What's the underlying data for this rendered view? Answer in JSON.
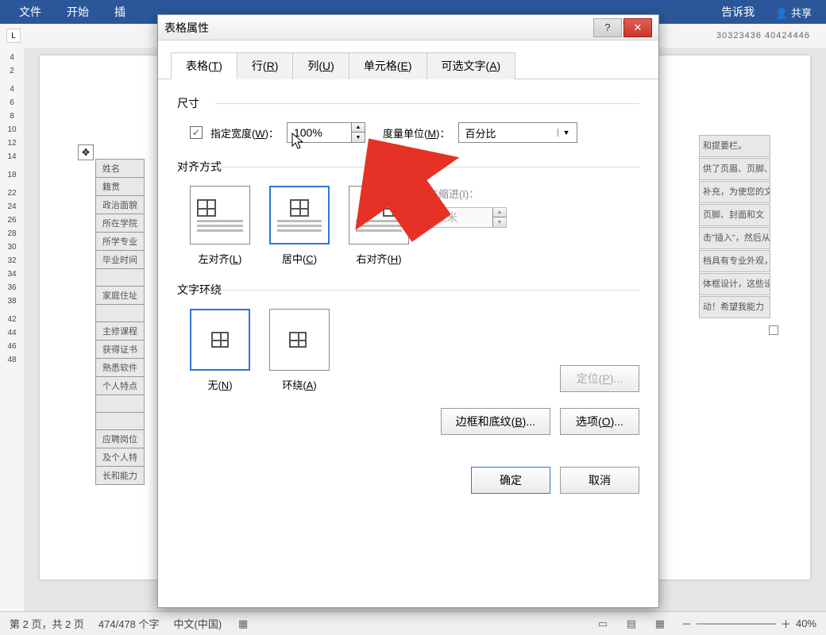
{
  "ribbon": {
    "file": "文件",
    "home": "开始",
    "insert": "插",
    "tellme": "告诉我",
    "share": "共享"
  },
  "ruler": {
    "right_nums": "30323436 40424446"
  },
  "vruler": [
    "4",
    "2",
    "",
    "4",
    "6",
    "8",
    "10",
    "12",
    "14",
    "",
    "18",
    "",
    "22",
    "24",
    "26",
    "28",
    "30",
    "32",
    "34",
    "36",
    "38",
    "",
    "42",
    "44",
    "46",
    "48"
  ],
  "doc_table": [
    "姓名",
    "籍贯",
    "政治面貌",
    "所在学院",
    "所学专业",
    "毕业时间",
    "",
    "家庭住址",
    "",
    "主修课程",
    "获得证书",
    "熟悉软件",
    "个人特点",
    "",
    "",
    "应聘岗位",
    "及个人特",
    "长和能力"
  ],
  "right_text": [
    "和提要栏。",
    "供了页眉、页脚、",
    "补充，为使您的文",
    "页脚、封面和文",
    "击\"插入\"，然后从",
    "档具有专业外观，",
    "体框设计，这些设",
    "动！希望我能力"
  ],
  "dialog": {
    "title": "表格属性",
    "tabs": {
      "table": "表格(T)",
      "row": "行(R)",
      "column": "列(U)",
      "cell": "单元格(E)",
      "alttext": "可选文字(A)"
    },
    "size_section": "尺寸",
    "width_check": "指定宽度(W)：",
    "width_value": "100%",
    "unit_label": "度量单位(M)：",
    "unit_value": "百分比",
    "align_section": "对齐方式",
    "align": {
      "left": "左对齐(L)",
      "center": "居中(C)",
      "right": "右对齐(H)"
    },
    "indent_label": "左缩进(I)：",
    "indent_value": "厘米",
    "wrap_section": "文字环绕",
    "wrap": {
      "none": "无(N)",
      "around": "环绕(A)"
    },
    "position_btn": "定位(P)...",
    "border_btn": "边框和底纹(B)...",
    "options_btn": "选项(O)...",
    "ok": "确定",
    "cancel": "取消"
  },
  "statusbar": {
    "page": "第 2 页，共 2 页",
    "words": "474/478 个字",
    "lang": "中文(中国)",
    "zoom": "40%"
  }
}
